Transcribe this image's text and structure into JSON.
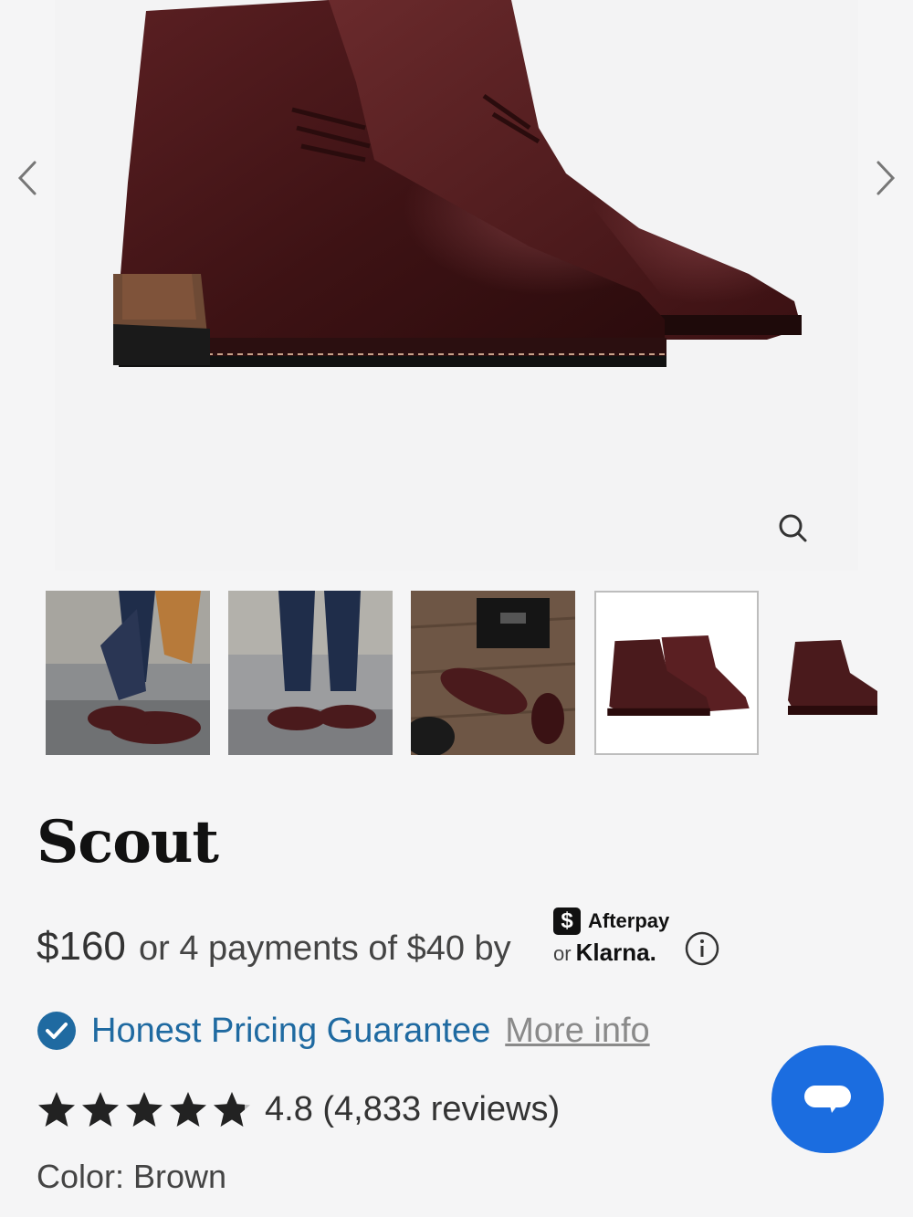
{
  "product": {
    "name": "Scout",
    "price": "$160",
    "installments_text": "or 4 payments of $40 by",
    "rating_text": "4.8 (4,833 reviews)",
    "rating_value": 4.8,
    "color_label": "Color: Brown"
  },
  "payments": {
    "afterpay_symbol": "$",
    "afterpay_label": "Afterpay",
    "klarna_or": "or",
    "klarna_label": "Klarna."
  },
  "guarantee": {
    "label": "Honest Pricing Guarantee",
    "link": "More info"
  },
  "gallery": {
    "thumbnails": [
      "lifestyle-tying-boot",
      "lifestyle-walking",
      "flatlay-with-box",
      "product-pair",
      "product-side"
    ],
    "selected_index": 3
  },
  "colors": {
    "leather": "#4a1a1c",
    "accent_blue": "#1f6aa1",
    "chat_blue": "#1b6de0"
  }
}
